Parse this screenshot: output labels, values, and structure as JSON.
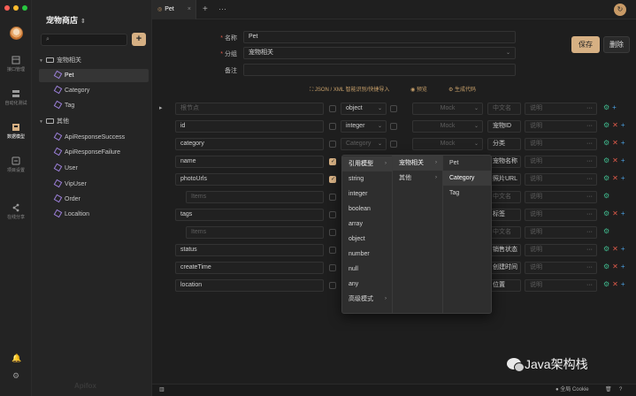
{
  "window": {
    "traffic_colors": [
      "#ff5f57",
      "#febc2e",
      "#28c840"
    ]
  },
  "rail": {
    "items": [
      {
        "label": "接口管理",
        "icon": "api-icon"
      },
      {
        "label": "自动化测试",
        "icon": "test-icon"
      },
      {
        "label": "数据模型",
        "icon": "model-icon",
        "active": true
      },
      {
        "label": "项目设置",
        "icon": "settings-icon"
      },
      {
        "label": "在线分享",
        "icon": "share-icon"
      }
    ]
  },
  "sidebar": {
    "project_title": "宠物商店",
    "search_placeholder": "",
    "add_label": "+",
    "tree": [
      {
        "label": "宠物相关",
        "kind": "folder",
        "depth": 0
      },
      {
        "label": "Pet",
        "kind": "model",
        "depth": 1,
        "selected": true
      },
      {
        "label": "Category",
        "kind": "model",
        "depth": 1
      },
      {
        "label": "Tag",
        "kind": "model",
        "depth": 1
      },
      {
        "label": "其他",
        "kind": "folder",
        "depth": 0
      },
      {
        "label": "ApiResponseSuccess",
        "kind": "model",
        "depth": 1
      },
      {
        "label": "ApiResponseFailure",
        "kind": "model",
        "depth": 1
      },
      {
        "label": "User",
        "kind": "model",
        "depth": 1
      },
      {
        "label": "VipUser",
        "kind": "model",
        "depth": 1
      },
      {
        "label": "Order",
        "kind": "model",
        "depth": 1
      },
      {
        "label": "Localtion",
        "kind": "model",
        "depth": 1
      }
    ],
    "footer_logo": "Apifox"
  },
  "tabs": {
    "active": "Pet"
  },
  "meta": {
    "name_label": "名称",
    "name_value": "Pet",
    "group_label": "分组",
    "group_value": "宠物相关",
    "remark_label": "备注",
    "remark_value": "",
    "save_label": "保存",
    "delete_label": "删除"
  },
  "tools": {
    "smart_import": "JSON / XML 智能识别/快捷导入",
    "preview": "预览",
    "generate_code": "生成代码"
  },
  "schema_rows": [
    {
      "name": "根节点",
      "placeholder": true,
      "type": "object",
      "mock": "Mock",
      "cn": "中文名",
      "desc": "说明",
      "root": true
    },
    {
      "name": "id",
      "type": "integer",
      "mock": "Mock",
      "cn": "宠物ID",
      "desc": "说明",
      "required": false
    },
    {
      "name": "category",
      "type": "Category",
      "type_placeholder": true,
      "mock": "Mock",
      "cn": "分类",
      "desc": "说明"
    },
    {
      "name": "name",
      "type": "",
      "mock": "",
      "cn": "宠物名称",
      "desc": "说明",
      "required": true
    },
    {
      "name": "photoUrls",
      "type": "",
      "mock": "",
      "cn": "照片URL",
      "desc": "说明",
      "required": true
    },
    {
      "name": "Items",
      "placeholder": true,
      "sub": true,
      "type": "",
      "mock": "",
      "cn": "中文名",
      "desc": "说明"
    },
    {
      "name": "tags",
      "type": "",
      "mock": "",
      "cn": "标签",
      "desc": "说明"
    },
    {
      "name": "Items",
      "placeholder": true,
      "sub": true,
      "type": "",
      "mock": "",
      "cn": "中文名",
      "desc": "说明"
    },
    {
      "name": "status",
      "type": "",
      "mock": "",
      "cn": "销售状态",
      "desc": "说明"
    },
    {
      "name": "createTime",
      "type": "",
      "mock": "",
      "cn": "创建时间",
      "desc": "说明"
    },
    {
      "name": "location",
      "type": "",
      "mock": "",
      "cn": "位置",
      "desc": "说明"
    }
  ],
  "type_menu": {
    "col1": [
      "引用模型",
      "string",
      "integer",
      "boolean",
      "array",
      "object",
      "number",
      "null",
      "any",
      "高级模式"
    ],
    "col2": [
      "宠物相关",
      "其他"
    ],
    "col3": [
      "Pet",
      "Category",
      "Tag"
    ]
  },
  "statusbar": {
    "cookie": "全局 Cookie"
  },
  "watermark": "Java架构栈"
}
